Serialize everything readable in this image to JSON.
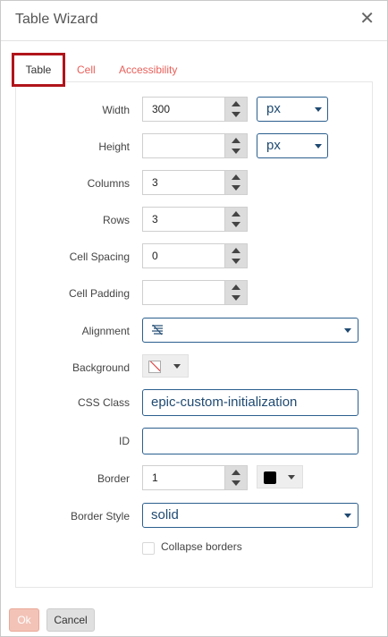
{
  "dialog": {
    "title": "Table Wizard"
  },
  "tabs": [
    {
      "label": "Table",
      "active": true
    },
    {
      "label": "Cell",
      "active": false
    },
    {
      "label": "Accessibility",
      "active": false
    }
  ],
  "fields": {
    "width": {
      "label": "Width",
      "value": "300",
      "unit": "px"
    },
    "height": {
      "label": "Height",
      "value": "",
      "unit": "px"
    },
    "columns": {
      "label": "Columns",
      "value": "3"
    },
    "rows": {
      "label": "Rows",
      "value": "3"
    },
    "cell_spacing": {
      "label": "Cell Spacing",
      "value": "0"
    },
    "cell_padding": {
      "label": "Cell Padding",
      "value": ""
    },
    "alignment": {
      "label": "Alignment",
      "value": "",
      "icon": "align-icon"
    },
    "background": {
      "label": "Background",
      "icon": "no-color-swatch-icon"
    },
    "css_class": {
      "label": "CSS Class",
      "value": "epic-custom-initialization"
    },
    "id": {
      "label": "ID",
      "value": ""
    },
    "border": {
      "label": "Border",
      "value": "1",
      "color": "#000000"
    },
    "border_style": {
      "label": "Border Style",
      "value": "solid"
    },
    "collapse": {
      "label": "Collapse borders",
      "checked": false
    }
  },
  "footer": {
    "ok_label": "Ok",
    "cancel_label": "Cancel"
  },
  "colors": {
    "active_tab_outline": "#b0141b",
    "tab_link": "#e8605a",
    "input_border": "#2b5f8e",
    "ok_bg": "#f3c3b7"
  }
}
